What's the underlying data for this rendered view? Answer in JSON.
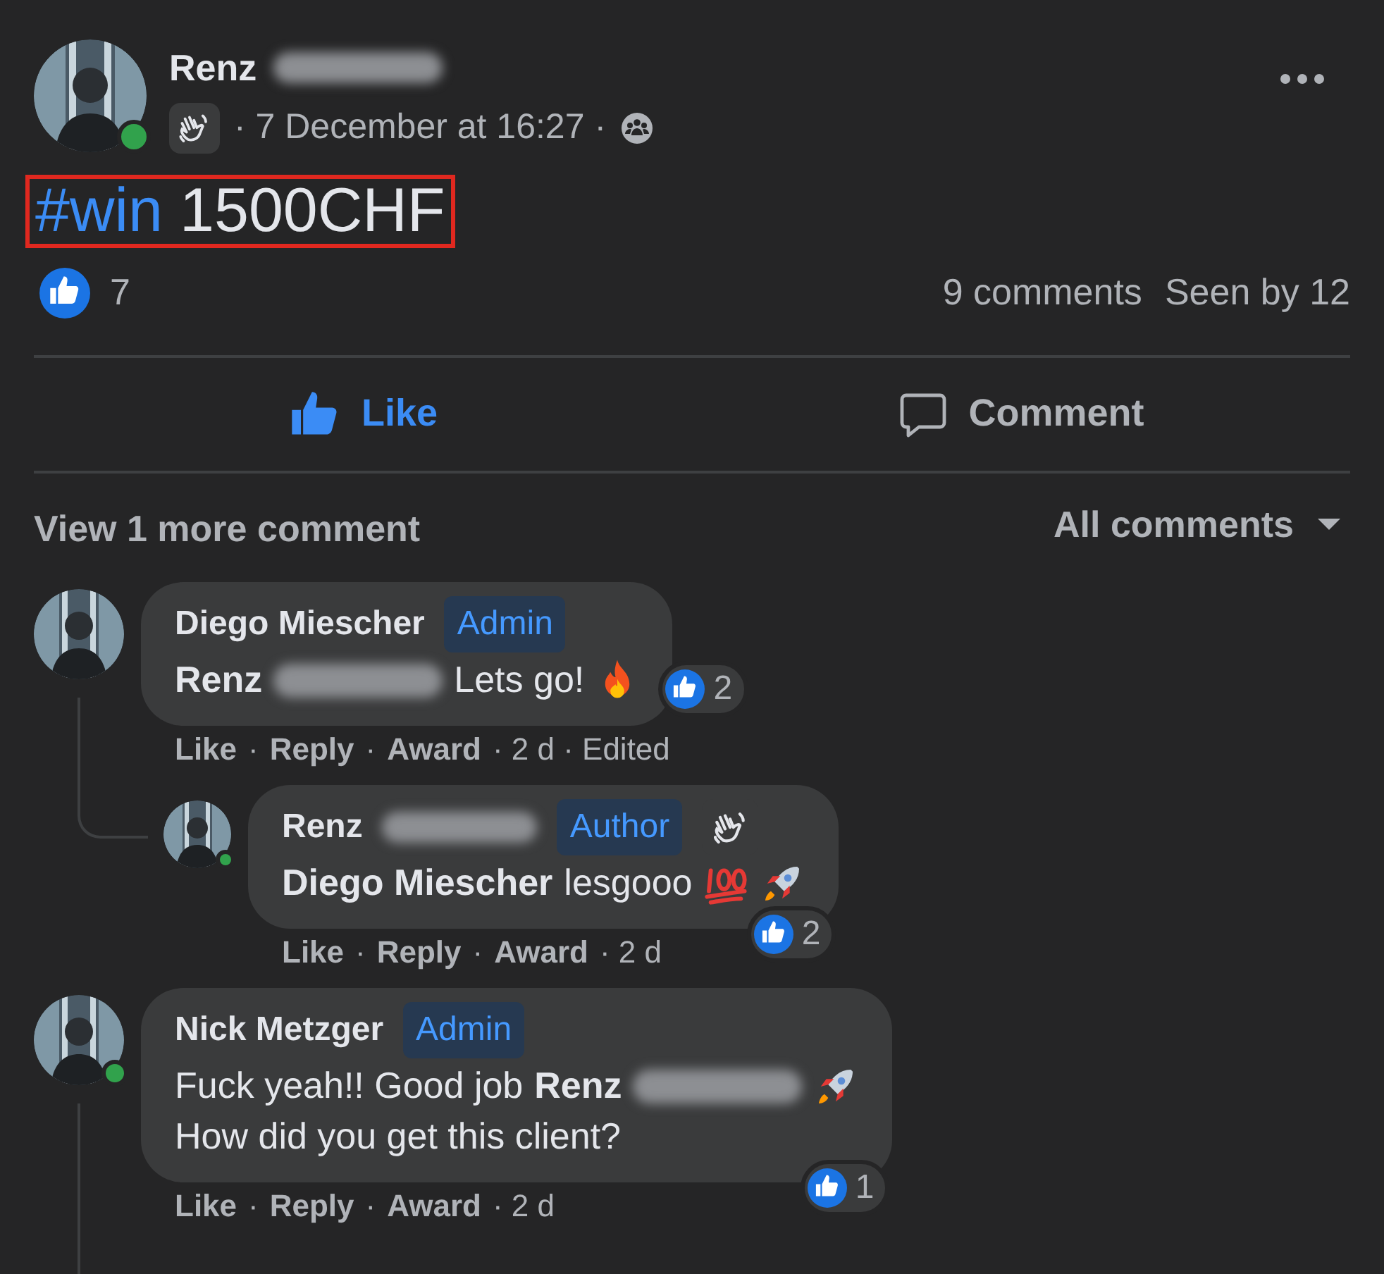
{
  "post": {
    "author": {
      "name": "Renz",
      "redacted": true,
      "online": true
    },
    "meta": "· 7 December at 16:27 ·",
    "hashtag": "#win",
    "text": "1500CHF",
    "highlighted": true,
    "like_count": "7",
    "comments_count": "9 comments",
    "seen_by": "Seen by 12",
    "actions": [
      {
        "kind": "like",
        "label": "Like",
        "selected": true
      },
      {
        "kind": "comment",
        "label": "Comment",
        "selected": false
      }
    ],
    "view_more": "View 1 more comment",
    "sort": "All comments"
  },
  "comments": [
    {
      "author": "Diego Miescher",
      "redacted": false,
      "online": false,
      "badge": "Admin",
      "wave_badge": false,
      "body": [
        {
          "kind": "mention",
          "text": "Renz"
        },
        {
          "kind": "redacted"
        },
        {
          "kind": "text",
          "text": "Lets go!"
        },
        {
          "kind": "fire"
        }
      ],
      "reactions": "2",
      "footer": [
        {
          "kind": "link",
          "text": "Like"
        },
        {
          "kind": "text",
          "text": "·"
        },
        {
          "kind": "link",
          "text": "Reply"
        },
        {
          "kind": "text",
          "text": "·"
        },
        {
          "kind": "link",
          "text": "Award"
        },
        {
          "kind": "text",
          "text": "· 2 d · Edited"
        }
      ],
      "replies": [
        {
          "author": "Renz",
          "redacted": true,
          "online": true,
          "badge": "Author",
          "wave_badge": true,
          "body": [
            {
              "kind": "mention",
              "text": "Diego Miescher"
            },
            {
              "kind": "text",
              "text": "lesgooo"
            },
            {
              "kind": "hundred"
            },
            {
              "kind": "rocket"
            }
          ],
          "reactions": "2",
          "footer": [
            {
              "kind": "link",
              "text": "Like"
            },
            {
              "kind": "text",
              "text": "·"
            },
            {
              "kind": "link",
              "text": "Reply"
            },
            {
              "kind": "text",
              "text": "·"
            },
            {
              "kind": "link",
              "text": "Award"
            },
            {
              "kind": "text",
              "text": "· 2 d"
            }
          ]
        }
      ]
    },
    {
      "author": "Nick Metzger",
      "redacted": false,
      "online": true,
      "badge": "Admin",
      "wave_badge": false,
      "body": [
        {
          "kind": "text",
          "text": "Fuck yeah!! Good job"
        },
        {
          "kind": "mention",
          "text": "Renz"
        },
        {
          "kind": "redacted"
        },
        {
          "kind": "rocket"
        },
        {
          "kind": "break"
        },
        {
          "kind": "text",
          "text": "How did you get this client?"
        }
      ],
      "reactions": "1",
      "footer": [
        {
          "kind": "link",
          "text": "Like"
        },
        {
          "kind": "text",
          "text": "·"
        },
        {
          "kind": "link",
          "text": "Reply"
        },
        {
          "kind": "text",
          "text": "·"
        },
        {
          "kind": "link",
          "text": "Award"
        },
        {
          "kind": "text",
          "text": "· 2 d"
        }
      ]
    }
  ]
}
